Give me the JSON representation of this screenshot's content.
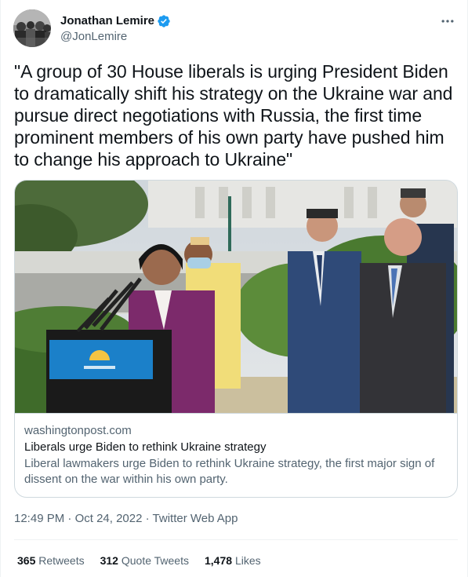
{
  "author": {
    "name": "Jonathan Lemire",
    "handle": "@JonLemire",
    "verified": true
  },
  "tweet": {
    "text": "\"A group of 30 House liberals is urging President Biden to dramatically shift his strategy on the Ukraine war and pursue direct negotiations with Russia, the first time prominent members of his own party have pushed him to change his approach to Ukraine\""
  },
  "card": {
    "domain": "washingtonpost.com",
    "title": "Liberals urge Biden to rethink Ukraine strategy",
    "description": "Liberal lawmakers urge Biden to rethink Ukraine strategy, the first major sign of dissent on the war within his own party."
  },
  "meta": {
    "time": "12:49 PM",
    "separator": "·",
    "date": "Oct 24, 2022",
    "source": "Twitter Web App"
  },
  "stats": {
    "retweets_count": "365",
    "retweets_label": "Retweets",
    "quotes_count": "312",
    "quotes_label": "Quote Tweets",
    "likes_count": "1,478",
    "likes_label": "Likes"
  },
  "icons": {
    "verified": "verified-badge-icon",
    "more": "more-options-icon"
  },
  "colors": {
    "verified": "#1d9bf0",
    "text_primary": "#0f1419",
    "text_secondary": "#536471",
    "border": "#cfd9de",
    "podium_blue": "#1b80c9"
  }
}
